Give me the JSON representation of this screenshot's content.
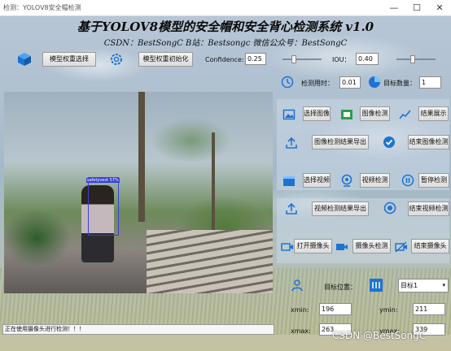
{
  "window": {
    "title": "检测：YOLOV8安全帽检测",
    "controls": {
      "minimize": "—",
      "maximize": "☐",
      "close": "✕"
    }
  },
  "header": {
    "title": "基于YOLOV8模型的安全帽和安全背心检测系统 v1.0",
    "subtitle": "CSDN：BestSongC   B站：Bestsongc   微信公众号：BestSongC"
  },
  "toolbar": {
    "model_select_label": "模型权重选择",
    "model_init_label": "模型权重初始化",
    "confidence_label": "Confidence:",
    "confidence_value": "0.25",
    "confidence_fraction": 0.25,
    "iou_label": "IOU：",
    "iou_value": "0.40",
    "iou_fraction": 0.4
  },
  "stats": {
    "time_label": "检测用时：",
    "time_value": "0.01",
    "count_label": "目标数量：",
    "count_value": "1"
  },
  "image_controls": {
    "select_image": "选择图像",
    "detect_image": "图像检测",
    "show_result": "结果展示",
    "export_image_result": "图像检测结果导出",
    "end_image_detect": "结束图像检测"
  },
  "video_controls": {
    "select_video": "选择视频",
    "detect_video": "视频检测",
    "pause_detect": "暂停检测",
    "export_video_result": "视频检测结果导出",
    "end_video_detect": "结束视频检测"
  },
  "camera_controls": {
    "open_camera": "打开摄像头",
    "camera_detect": "摄像头检测",
    "close_camera": "结束摄像头"
  },
  "target": {
    "position_label": "目标位置：",
    "selected_target": "目标1",
    "xmin_label": "xmin:",
    "xmin_value": "196",
    "ymin_label": "ymin:",
    "ymin_value": "211",
    "xmax_label": "xmax:",
    "xmax_value": "263",
    "ymax_label": "ymax:",
    "ymax_value": "339"
  },
  "detection": {
    "label": "safetyvest 57%"
  },
  "status": {
    "message": "正在使用摄像头进行检测！！！"
  },
  "watermark": "CSDN @BestSongC",
  "colors": {
    "accent_blue": "#1e73d2",
    "bbox": "#3a3fd8"
  }
}
